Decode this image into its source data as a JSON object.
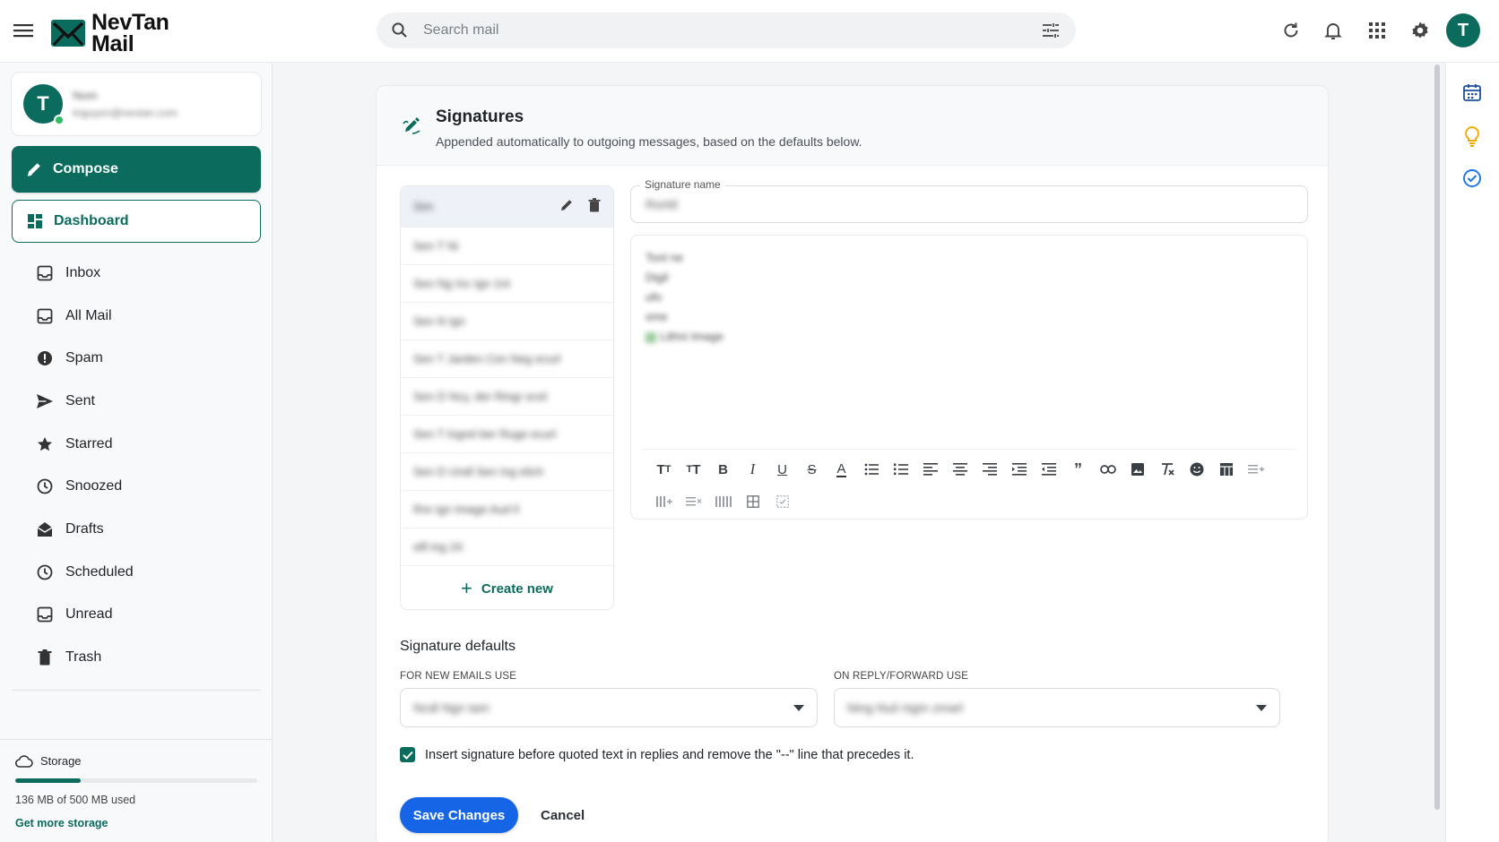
{
  "app": {
    "name_line1": "NevTan",
    "name_line2": "Mail",
    "brand_color": "#0b6b5d"
  },
  "header": {
    "search_placeholder": "Search mail",
    "avatar_letter": "T",
    "icons": [
      "menu-icon",
      "search-icon",
      "tune-icon",
      "refresh-icon",
      "bell-icon",
      "apps-grid-icon",
      "gear-icon"
    ]
  },
  "sidebar": {
    "account": {
      "avatar_letter": "T",
      "name": "Nom",
      "email": "tnguyen@nevtan.com"
    },
    "compose_label": "Compose",
    "dashboard_label": "Dashboard",
    "items": [
      {
        "label": "Inbox",
        "icon": "inbox-icon"
      },
      {
        "label": "All Mail",
        "icon": "all-mail-icon"
      },
      {
        "label": "Spam",
        "icon": "spam-icon"
      },
      {
        "label": "Sent",
        "icon": "send-icon"
      },
      {
        "label": "Starred",
        "icon": "star-icon"
      },
      {
        "label": "Snoozed",
        "icon": "clock-icon"
      },
      {
        "label": "Drafts",
        "icon": "drafts-icon"
      },
      {
        "label": "Scheduled",
        "icon": "clock-icon"
      },
      {
        "label": "Unread",
        "icon": "unread-icon"
      },
      {
        "label": "Trash",
        "icon": "trash-icon"
      }
    ],
    "storage": {
      "label": "Storage",
      "used_text": "136 MB of 500 MB used",
      "used_fraction": 0.272,
      "more_link": "Get more storage"
    }
  },
  "signatures": {
    "title": "Signatures",
    "subtitle": "Appended automatically to outgoing messages, based on the defaults below.",
    "list": [
      "Sim",
      "Sen T Ni",
      "Sen Ng Inc Ign 1nt",
      "Sen N Ign",
      "Sen T Jarden Cen Neg ecurl",
      "Sen D Ncy, der Ringr ecel",
      "Sen T Ingrel ber Ruge ecurl",
      "Sen D Undl Sen Ing elich",
      "Rre Ign Image Aud ll",
      "elll ing 24"
    ],
    "create_label": "Create new",
    "name_field_label": "Signature name",
    "name_field_value": "Rontil",
    "editor_lines": [
      "Tonl ne",
      "Digil",
      "ufo",
      "sme",
      "Lithni Image"
    ],
    "toolbar_icons": [
      "font-size-icon",
      "text-height-icon",
      "bold-icon",
      "italic-icon",
      "underline-icon",
      "strikethrough-icon",
      "text-color-icon",
      "bullet-list-icon",
      "numbered-list-icon",
      "align-left-icon",
      "align-center-icon",
      "align-right-icon",
      "indent-decrease-icon",
      "indent-increase-icon",
      "quote-icon",
      "link-icon",
      "image-icon",
      "clear-format-icon",
      "emoji-icon",
      "table-icon",
      "insert-row-icon",
      "insert-column-icon",
      "delete-row-icon",
      "delete-column-icon",
      "grid-icon",
      "checkbox-icon"
    ],
    "defaults_title": "Signature defaults",
    "new_emails_label": "FOR NEW EMAILS USE",
    "new_emails_value": "Ncdl Ngn tam",
    "reply_label": "ON REPLY/FORWARD USE",
    "reply_value": "Ning Nuil nigm zmarl",
    "checkbox_text": "Insert signature before quoted text in replies and remove the \"--\" line that precedes it.",
    "checkbox_checked": true,
    "save_label": "Save Changes",
    "cancel_label": "Cancel"
  }
}
